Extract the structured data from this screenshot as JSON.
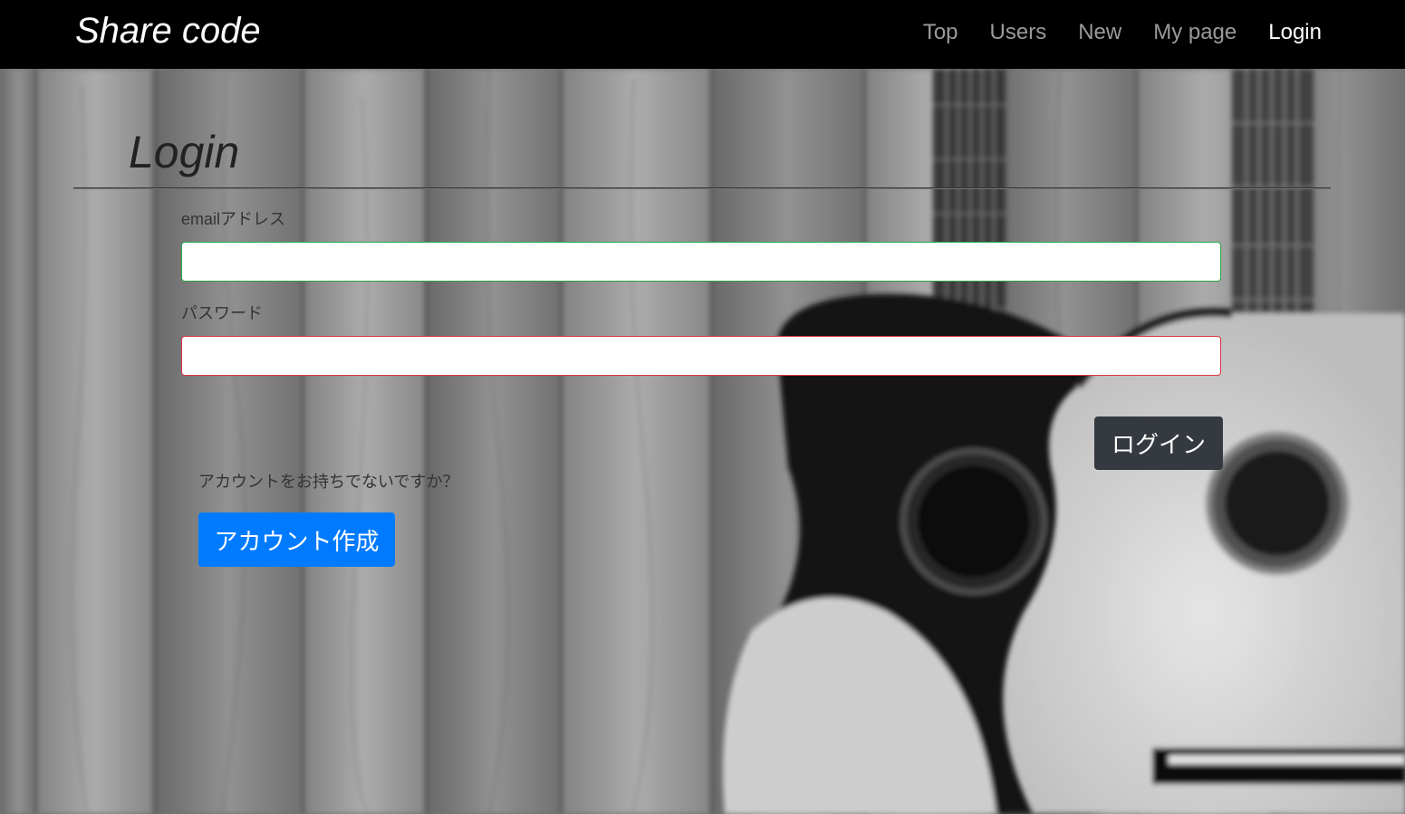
{
  "navbar": {
    "brand": "Share code",
    "links": [
      {
        "label": "Top",
        "active": false
      },
      {
        "label": "Users",
        "active": false
      },
      {
        "label": "New",
        "active": false
      },
      {
        "label": "My page",
        "active": false
      },
      {
        "label": "Login",
        "active": true
      }
    ]
  },
  "main": {
    "title": "Login",
    "email": {
      "label": "emailアドレス",
      "value": "",
      "border_color": "#28a745"
    },
    "password": {
      "label": "パスワード",
      "value": "",
      "border_color": "#dc3545"
    },
    "login_button": "ログイン",
    "signup_prompt": "アカウントをお持ちでないですか？",
    "signup_button": "アカウント作成"
  },
  "colors": {
    "navbar_bg": "#000000",
    "nav_link": "#9a9a9a",
    "nav_link_active": "#ffffff",
    "login_button_bg": "#343a40",
    "signup_button_bg": "#007bff"
  },
  "background_image": "blurred black-and-white photo of wooden planks with two acoustic guitars"
}
